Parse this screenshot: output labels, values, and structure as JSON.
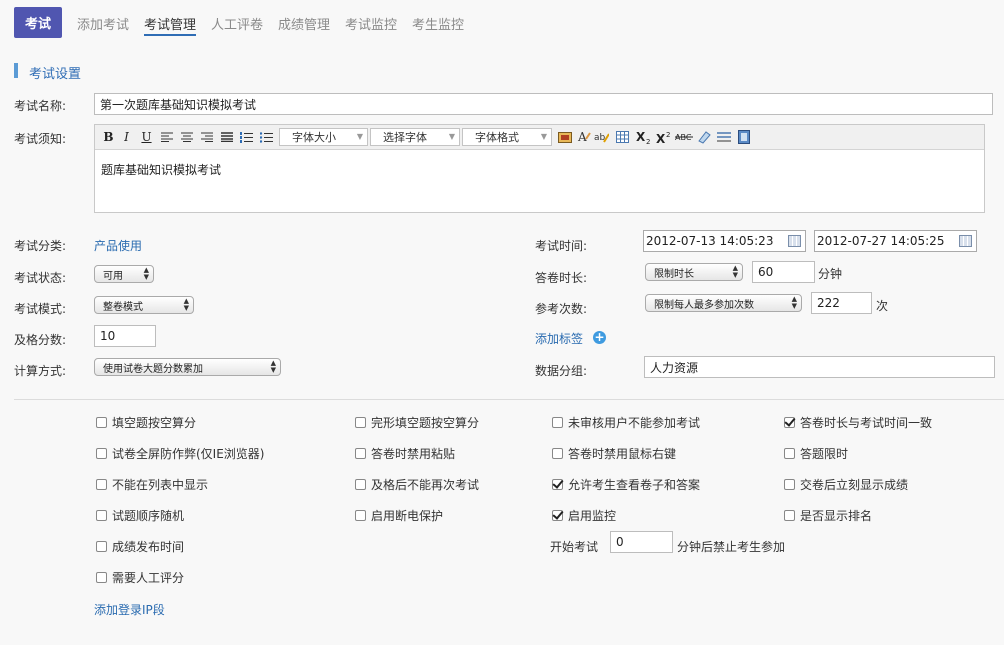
{
  "nav": {
    "brand": "考试",
    "items": [
      "添加考试",
      "考试管理",
      "人工评卷",
      "成绩管理",
      "考试监控",
      "考生监控"
    ],
    "active_index": 1
  },
  "section": {
    "title": "考试设置"
  },
  "form": {
    "name_label": "考试名称:",
    "name_value": "第一次题库基础知识模拟考试",
    "notice_label": "考试须知:",
    "notice_content": "题库基础知识模拟考试",
    "editor_toolbar": {
      "buttons": [
        "B",
        "I",
        "U"
      ],
      "font_size": "字体大小",
      "font_family": "选择字体",
      "font_format": "字体格式"
    },
    "category_label": "考试分类:",
    "category_value": "产品使用",
    "status_label": "考试状态:",
    "status_value": "可用",
    "mode_label": "考试模式:",
    "mode_value": "整卷模式",
    "pass_label": "及格分数:",
    "pass_value": "10",
    "calc_label": "计算方式:",
    "calc_value": "使用试卷大题分数累加",
    "time_label": "考试时间:",
    "start_time": "2012-07-13 14:05:23",
    "end_time": "2012-07-27 14:05:25",
    "duration_label": "答卷时长:",
    "duration_mode": "限制时长",
    "duration_value": "60",
    "duration_unit": "分钟",
    "attempts_label": "参考次数:",
    "attempts_mode": "限制每人最多参加次数",
    "attempts_value": "222",
    "attempts_unit": "次",
    "add_tag": "添加标签",
    "group_label": "数据分组:",
    "group_value": "人力资源"
  },
  "options": [
    {
      "label": "填空题按空算分",
      "checked": false
    },
    {
      "label": "完形填空题按空算分",
      "checked": false
    },
    {
      "label": "未审核用户不能参加考试",
      "checked": false
    },
    {
      "label": "答卷时长与考试时间一致",
      "checked": true
    },
    {
      "label": "试卷全屏防作弊(仅IE浏览器)",
      "checked": false
    },
    {
      "label": "答卷时禁用粘贴",
      "checked": false
    },
    {
      "label": "答卷时禁用鼠标右键",
      "checked": false
    },
    {
      "label": "答题限时",
      "checked": false
    },
    {
      "label": "不能在列表中显示",
      "checked": false
    },
    {
      "label": "及格后不能再次考试",
      "checked": false
    },
    {
      "label": "允许考生查看卷子和答案",
      "checked": true
    },
    {
      "label": "交卷后立刻显示成绩",
      "checked": false
    },
    {
      "label": "试题顺序随机",
      "checked": false
    },
    {
      "label": "启用断电保护",
      "checked": false
    },
    {
      "label": "启用监控",
      "checked": true
    },
    {
      "label": "是否显示排名",
      "checked": false
    },
    {
      "label": "成绩发布时间",
      "checked": false
    },
    {
      "label": "需要人工评分",
      "checked": false
    }
  ],
  "start_exam": {
    "label": "开始考试",
    "value": "0",
    "suffix": "分钟后禁止考生参加"
  },
  "add_ip": "添加登录IP段"
}
